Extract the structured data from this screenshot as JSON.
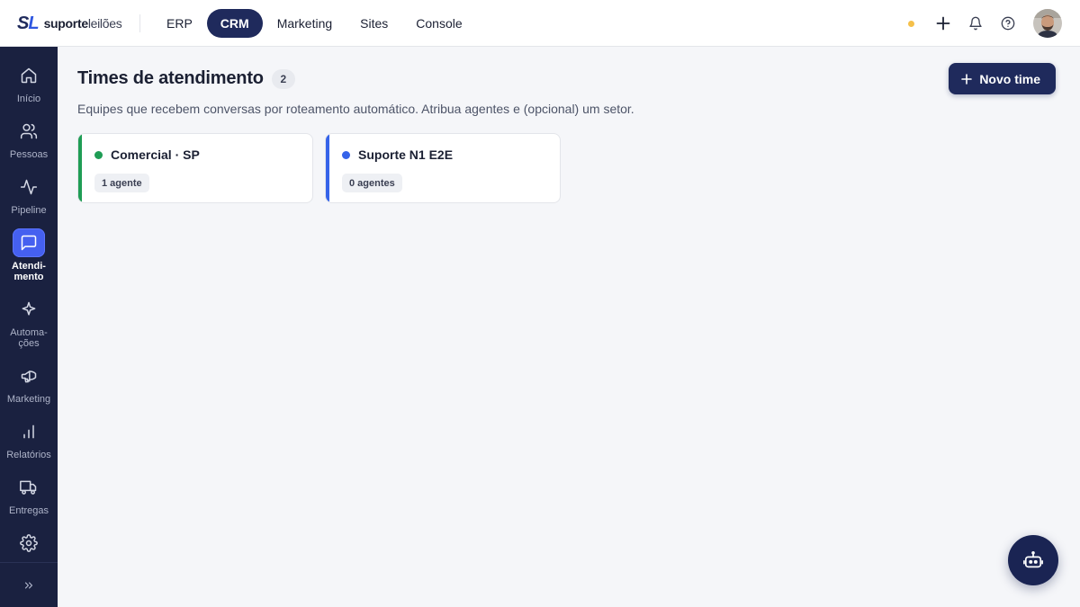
{
  "brand": {
    "mark_s": "S",
    "mark_l": "L",
    "name_bold": "suporte",
    "name_light": "leilões"
  },
  "topnav": [
    {
      "label": "ERP",
      "active": false
    },
    {
      "label": "CRM",
      "active": true
    },
    {
      "label": "Marketing",
      "active": false
    },
    {
      "label": "Sites",
      "active": false
    },
    {
      "label": "Console",
      "active": false
    }
  ],
  "topbar_icons": [
    "status-dot",
    "plus-icon",
    "bell-icon",
    "help-icon",
    "avatar"
  ],
  "sidebar": {
    "items": [
      {
        "label": "Início",
        "icon": "home-icon"
      },
      {
        "label": "Pessoas",
        "icon": "users-icon"
      },
      {
        "label": "Pipeline",
        "icon": "activity-icon"
      },
      {
        "label": "Atendi-\nmento",
        "icon": "chat-icon",
        "active": true
      },
      {
        "label": "Automa-\nções",
        "icon": "sparkle-icon"
      },
      {
        "label": "Marketing",
        "icon": "megaphone-icon"
      },
      {
        "label": "Relatórios",
        "icon": "bar-chart-icon"
      },
      {
        "label": "Entregas",
        "icon": "truck-icon"
      },
      {
        "label": "",
        "icon": "gear-icon"
      }
    ],
    "collapse_icon": "double-chevron-right-icon"
  },
  "page": {
    "title": "Times de atendimento",
    "count": "2",
    "subtitle": "Equipes que recebem conversas por roteamento automático. Atribua agentes e (opcional) um setor.",
    "new_button": "Novo time"
  },
  "teams": [
    {
      "name": "Comercial · SP",
      "agents": "1 agente",
      "color": "#1f9d55"
    },
    {
      "name": "Suporte N1 E2E",
      "agents": "0 agentes",
      "color": "#3563e9"
    }
  ],
  "colors": {
    "primary": "#1f2a5c",
    "sidebar": "#1a2140",
    "active_sidebar": "#4560f0",
    "status_dot": "#f5c04a"
  },
  "fab": {
    "icon": "bot-icon"
  }
}
